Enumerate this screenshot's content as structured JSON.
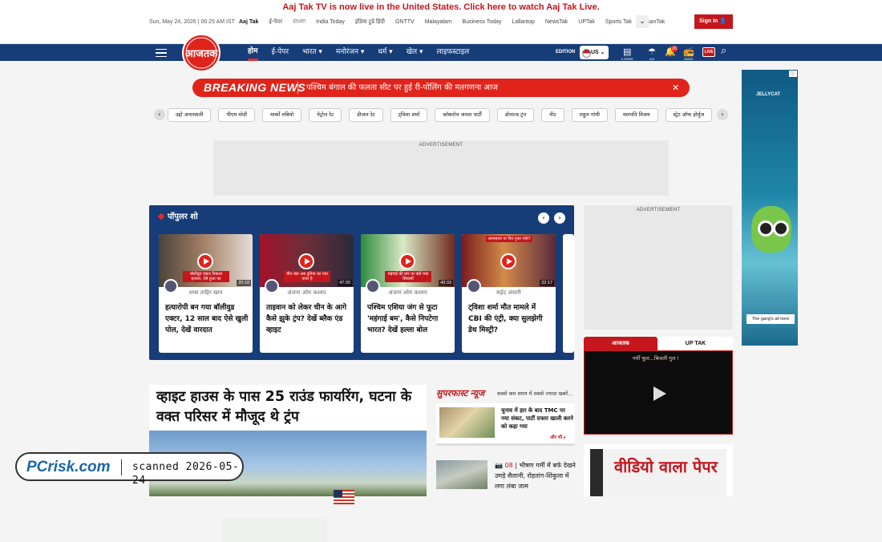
{
  "promo": {
    "text": "Aaj Tak TV is now live in the United States. Click here to watch Aaj Tak Live."
  },
  "topbar": {
    "date": "Sun, May 24, 2026 | 06:25 AM IST",
    "links": [
      "Aaj Tak",
      "ई-पेपर",
      "বাংলা",
      "India Today",
      "इंडिया टुडे हिंदी",
      "GNTTV",
      "Malayalam",
      "Business Today",
      "Lallantop",
      "NewsTak",
      "UPTak",
      "Sports Tak",
      "KisanTak"
    ],
    "more_icon": "chevron-down-icon",
    "signin_label": "Sign In"
  },
  "logo": {
    "text": "आजतक"
  },
  "nav": {
    "items": [
      "होम",
      "ई-पेपर",
      "भारत ▾",
      "मनोरंजन ▾",
      "धर्म ▾",
      "खेल ▾",
      "लाइफस्टाइल"
    ],
    "edition_label": "EDITION",
    "edition_value": "US",
    "icons": {
      "epaper_label": "E-PAPER",
      "aqi_label": "AQI",
      "notif_count": "20",
      "radio_label": "RADIO",
      "live_label": "LIVE"
    }
  },
  "breaking": {
    "label": "BREAKING NEWS",
    "text": "पश्चिम बंगाल की फलता सीट पर हुई री-पोलिंग की मतगणना आज",
    "close": "✕"
  },
  "chips": [
    "उद्दो अनारकली",
    "पीएम मोदी",
    "मार्को रुबियो",
    "पेट्रोल रेट",
    "डीजल रेट",
    "ट्विशा शर्मा",
    "कॉकरोच जनता पार्टी",
    "डोनाल्ड ट्रंप",
    "नीट",
    "राहुल गांधी",
    "थलपति विजय",
    "स्ट्रेट ऑफ होर्मुज"
  ],
  "ads": {
    "label": "ADVERTISEMENT",
    "side": {
      "brand": "JELLYCAT",
      "caption": "The gang's all here"
    }
  },
  "popular": {
    "title": "पॉपुलर शो",
    "cards": [
      {
        "host": "शम्स ताहिर खान",
        "headline": "हत्यारोपी बन गया बॉलीवुड एक्टर, 12 साल बाद ऐसे खुली पोल, देखें वारदात",
        "duration": "20:18",
        "overlay": "बॉलीवुड एक्टर निकला हत्यारा, ऐसे हुआ फा"
      },
      {
        "host": "अंजना ओम कश्यप",
        "headline": "ताइवान को लेकर चीन के आगे कैसे झुके ट्रंप? देखें ब्लैक एंड व्हाइट",
        "duration": "47:20",
        "overlay": "चीन क्या अब दुनिया का नया पावर है"
      },
      {
        "host": "अंजना ओम कश्यप",
        "headline": "पश्चिम एशिया जंग से फूटा 'महंगाई बम', कैसे निपटेगा भारत? देखें हल्ला बोल",
        "duration": "43:33",
        "overlay": "महंगाई की मार पर क्यों मचा सियासी"
      },
      {
        "host": "सईद अंसारी",
        "headline": "ट्विशा शर्मा मौत मामले में CBI की एंट्री, क्या सुलझेगी डेथ मिस्ट्री?",
        "duration": "22:17",
        "overlay": "आत्महत्या या फिर हुआ मर्डर?"
      }
    ]
  },
  "tabs": {
    "left": "आजतक",
    "right": "UP TAK"
  },
  "video": {
    "caption": "गर्मी फूल...बिजली गुल !"
  },
  "lead": {
    "headline": "व्हाइट हाउस के पास 25 राउंड फायरिंग, घटना के वक्त परिसर में मौजूद थे ट्रंप"
  },
  "superfast": {
    "logo": "सुपरफास्ट न्यूज",
    "subtitle": "सबसे कम समय में सबसे ज्यादा खबरें...",
    "story": "चुनाव में हार के बाद TMC पर नया संकट, पार्टी दफ्तर खाली करने को कहा गया",
    "more": "और भी ▸"
  },
  "story2": {
    "count": "08",
    "text": "भीषण गर्मी में बर्फ देखने उमड़े सैलानी, रोहतांग-शिंकुला में लगा लंबा जाम"
  },
  "paper": {
    "title": "वीडियो वाला पेपर"
  },
  "watermark": {
    "brand": "PCrisk.com",
    "scanned": "scanned 2026-05-24"
  }
}
